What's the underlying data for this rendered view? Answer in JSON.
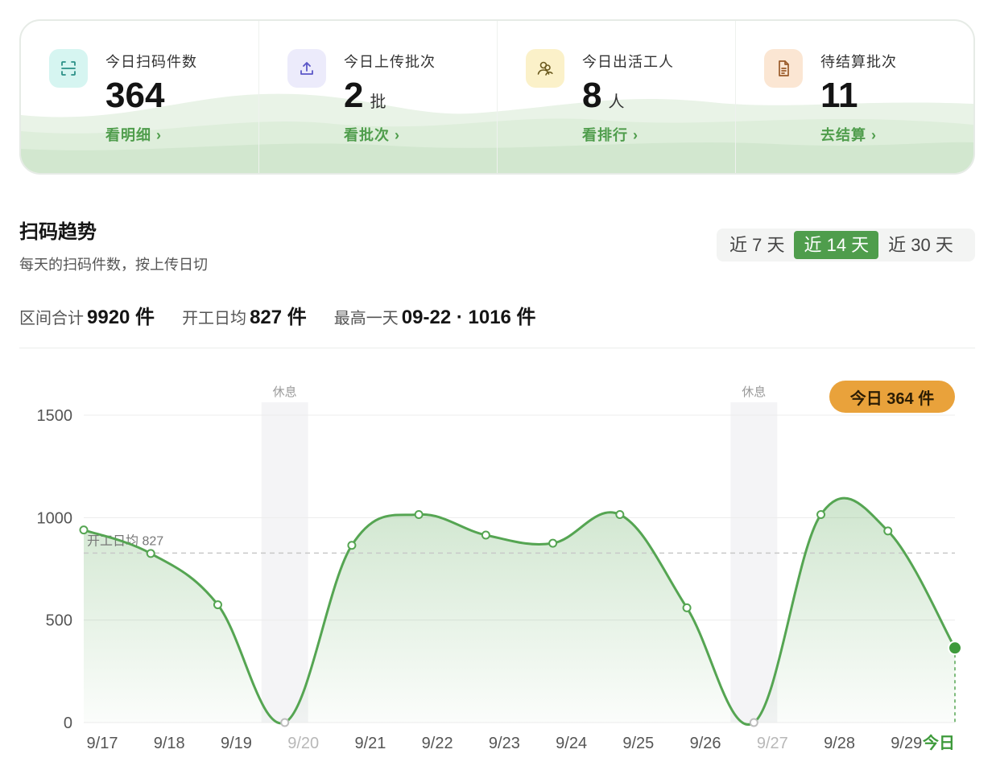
{
  "kpis": [
    {
      "label": "今日扫码件数",
      "value": "364",
      "unit": "",
      "link": "看明细 ›",
      "icon": "scan-icon",
      "icon_bg": "#d6f5f1",
      "icon_color": "#2a8f86"
    },
    {
      "label": "今日上传批次",
      "value": "2",
      "unit": "批",
      "link": "看批次 ›",
      "icon": "upload-icon",
      "icon_bg": "#ecebfb",
      "icon_color": "#5b57c7"
    },
    {
      "label": "今日出活工人",
      "value": "8",
      "unit": "人",
      "link": "看排行 ›",
      "icon": "workers-icon",
      "icon_bg": "#fbf1c9",
      "icon_color": "#6b5a1e"
    },
    {
      "label": "待结算批次",
      "value": "11",
      "unit": "",
      "link": "去结算 ›",
      "icon": "document-icon",
      "icon_bg": "#fbe6d3",
      "icon_color": "#9a5a28"
    }
  ],
  "trend": {
    "title": "扫码趋势",
    "subtitle": "每天的扫码件数，按上传日切",
    "ranges": [
      {
        "label": "近 7 天",
        "active": false
      },
      {
        "label": "近 14 天",
        "active": true
      },
      {
        "label": "近 30 天",
        "active": false
      }
    ],
    "stats": [
      {
        "label": "区间合计",
        "value": "9920 件"
      },
      {
        "label": "开工日均",
        "value": "827 件"
      },
      {
        "label": "最高一天",
        "value": "09-22 · 1016 件"
      }
    ],
    "today_badge": "今日 364 件"
  },
  "chart_data": {
    "type": "area",
    "categories": [
      "9/17",
      "9/18",
      "9/19",
      "9/20",
      "9/21",
      "9/22",
      "9/23",
      "9/24",
      "9/25",
      "9/26",
      "9/27",
      "9/28",
      "9/29",
      "今日"
    ],
    "values": [
      940,
      825,
      575,
      0,
      865,
      1015,
      915,
      875,
      1015,
      560,
      0,
      1015,
      935,
      364
    ],
    "rest_days": [
      "9/20",
      "9/27"
    ],
    "rest_label": "休息",
    "avg_line": {
      "label": "开工日均 827",
      "value": 827
    },
    "y_ticks": [
      0,
      500,
      1000,
      1500
    ],
    "ylim": [
      0,
      1500
    ],
    "line_color": "#55a552",
    "today_color": "#3e9a3b",
    "rest_color": "#bdbdbd"
  }
}
